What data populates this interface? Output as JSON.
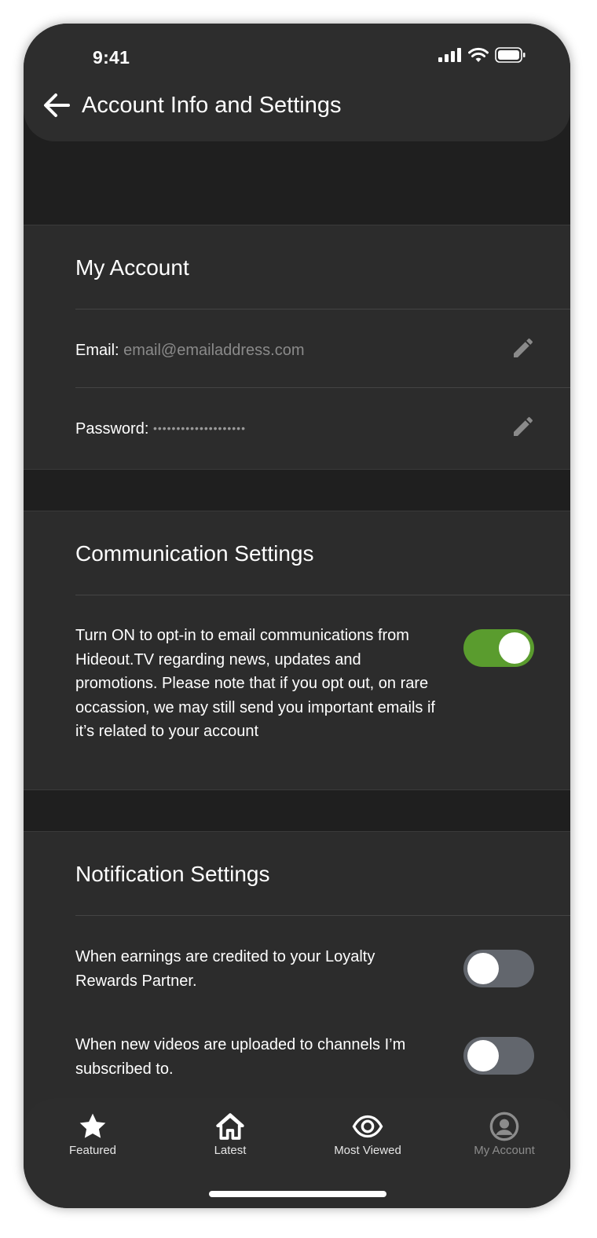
{
  "status": {
    "time": "9:41"
  },
  "header": {
    "title": "Account Info and Settings"
  },
  "my_account": {
    "title": "My Account",
    "email_label": "Email:",
    "email_value": "email@emailaddress.com",
    "password_label": "Password:",
    "password_value": "••••••••••••••••••••"
  },
  "communication": {
    "title": "Communication Settings",
    "description": "Turn ON to opt-in to email communications from Hideout.TV regarding news, updates and promotions. Please note that if you opt out, on rare occassion, we may still send you important emails if it’s related to your account",
    "toggle_state": "on"
  },
  "notifications": {
    "title": "Notification Settings",
    "items": [
      {
        "text": "When earnings are credited to your Loyalty Rewards Partner.",
        "toggle_state": "off"
      },
      {
        "text": "When new videos are uploaded to channels I’m subscribed to.",
        "toggle_state": "off"
      }
    ]
  },
  "tabbar": {
    "tabs": [
      {
        "label": "Featured",
        "icon": "star-icon"
      },
      {
        "label": "Latest",
        "icon": "home-icon"
      },
      {
        "label": "Most Viewed",
        "icon": "eye-icon"
      },
      {
        "label": "My Account",
        "icon": "user-circle-icon"
      }
    ]
  },
  "colors": {
    "toggle_on": "#5a9c2e",
    "toggle_off": "#62666d",
    "background": "#1f1f1f",
    "surface": "#2c2c2c"
  }
}
